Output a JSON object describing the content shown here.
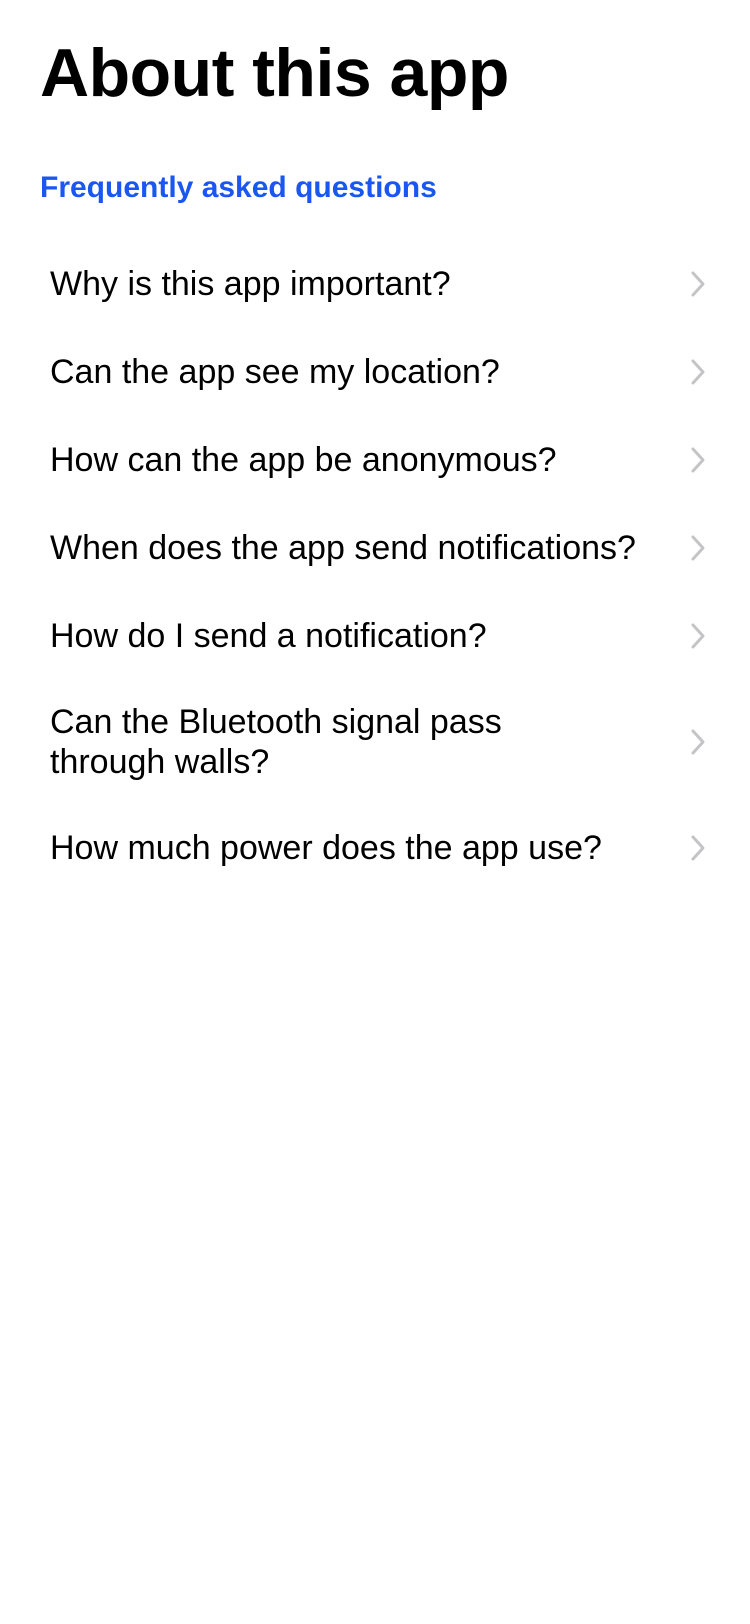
{
  "header": {
    "title": "About this app"
  },
  "faq": {
    "section_title": "Frequently asked questions",
    "items": [
      {
        "label": "Why is this app important?"
      },
      {
        "label": "Can the app see my location?"
      },
      {
        "label": "How can the app be anonymous?"
      },
      {
        "label": "When does the app send notifications?"
      },
      {
        "label": "How do I send a notification?"
      },
      {
        "label": "Can the Bluetooth signal pass through walls?"
      },
      {
        "label": "How much power does the app use?"
      }
    ],
    "row_icon": "chevron-right-icon"
  },
  "colors": {
    "accent": "#1a56f0",
    "chevron": "#c4c4c7",
    "text": "#000000",
    "background": "#ffffff"
  }
}
